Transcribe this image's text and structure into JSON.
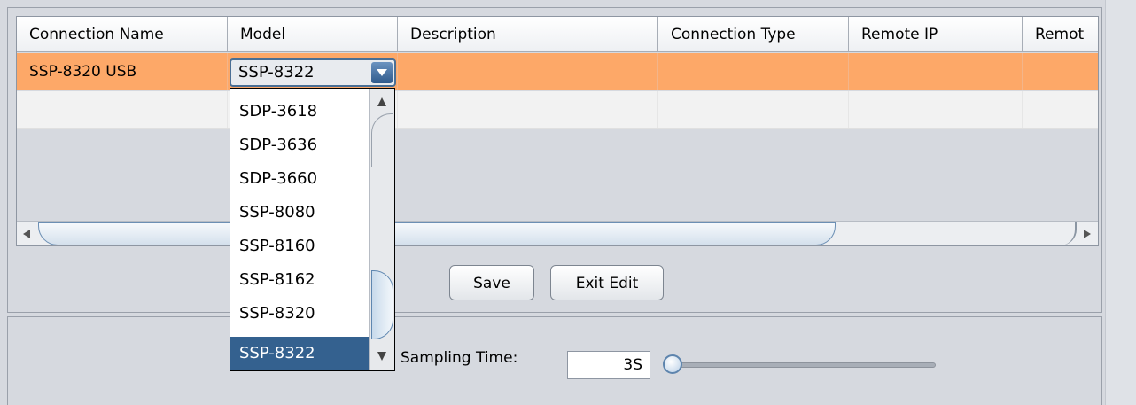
{
  "table": {
    "columns": [
      "Connection Name",
      "Model",
      "Description",
      "Connection Type",
      "Remote IP",
      "Remot"
    ],
    "rows": [
      [
        "SSP-8320 USB",
        "SSP-8322",
        "",
        "",
        "",
        ""
      ],
      [
        "",
        "",
        "",
        "",
        "",
        ""
      ]
    ]
  },
  "model_combo": {
    "value": "SSP-8322",
    "options": [
      "SDP-3618",
      "SDP-3636",
      "SDP-3660",
      "SSP-8080",
      "SSP-8160",
      "SSP-8162",
      "SSP-8320",
      "SSP-8322"
    ],
    "selected": "SSP-8322"
  },
  "buttons": {
    "save": "Save",
    "exit_edit": "Exit Edit"
  },
  "sampling": {
    "label": "Sampling Time:",
    "value": "3S"
  }
}
